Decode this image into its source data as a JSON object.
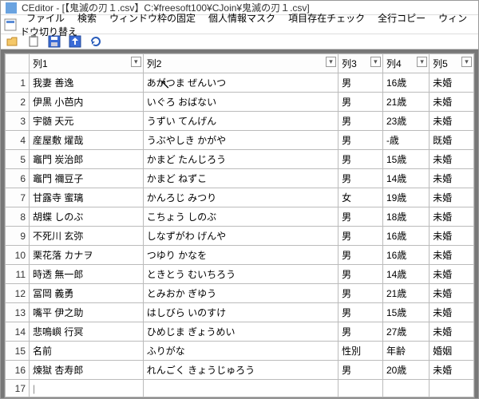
{
  "title": "CEditor - [【鬼滅の刃１.csv】C:¥freesoft100¥CJoin¥鬼滅の刃１.csv]",
  "menus": [
    "ファイル",
    "検索",
    "ウィンドウ枠の固定",
    "個人情報マスク",
    "項目存在チェック",
    "全行コピー",
    "ウィンドウ切り替え"
  ],
  "columns": [
    "",
    "列1",
    "列2",
    "列3",
    "列4",
    "列5"
  ],
  "rows": [
    {
      "n": "1",
      "c": [
        "我妻 善逸",
        "あがつま ぜんいつ",
        "男",
        "16歳",
        "未婚"
      ]
    },
    {
      "n": "2",
      "c": [
        "伊黒 小芭内",
        "いぐろ おばない",
        "男",
        "21歳",
        "未婚"
      ]
    },
    {
      "n": "3",
      "c": [
        "宇髄 天元",
        "うずい てんげん",
        "男",
        "23歳",
        "未婚"
      ]
    },
    {
      "n": "4",
      "c": [
        "産屋敷 燿哉",
        "うぶやしき かがや",
        "男",
        "-歳",
        "既婚"
      ]
    },
    {
      "n": "5",
      "c": [
        "竈門 炭治郎",
        "かまど たんじろう",
        "男",
        "15歳",
        "未婚"
      ]
    },
    {
      "n": "6",
      "c": [
        "竈門 禰豆子",
        "かまど ねずこ",
        "男",
        "14歳",
        "未婚"
      ]
    },
    {
      "n": "7",
      "c": [
        "甘露寺 蜜璃",
        "かんろじ みつり",
        "女",
        "19歳",
        "未婚"
      ]
    },
    {
      "n": "8",
      "c": [
        "胡蝶 しのぶ",
        "こちょう しのぶ",
        "男",
        "18歳",
        "未婚"
      ]
    },
    {
      "n": "9",
      "c": [
        "不死川 玄弥",
        "しなずがわ げんや",
        "男",
        "16歳",
        "未婚"
      ]
    },
    {
      "n": "10",
      "c": [
        "栗花落 カナヲ",
        "つゆり かなを",
        "男",
        "16歳",
        "未婚"
      ]
    },
    {
      "n": "11",
      "c": [
        "時透 無一郎",
        "ときとう むいちろう",
        "男",
        "14歳",
        "未婚"
      ]
    },
    {
      "n": "12",
      "c": [
        "冨岡 義勇",
        "とみおか ぎゆう",
        "男",
        "21歳",
        "未婚"
      ]
    },
    {
      "n": "13",
      "c": [
        "嘴平 伊之助",
        "はしびら いのすけ",
        "男",
        "15歳",
        "未婚"
      ]
    },
    {
      "n": "14",
      "c": [
        "悲鳴嶼 行冥",
        "ひめじま ぎょうめい",
        "男",
        "27歳",
        "未婚"
      ]
    },
    {
      "n": "15",
      "c": [
        "名前",
        "ふりがな",
        "性別",
        "年齢",
        "婚姻"
      ]
    },
    {
      "n": "16",
      "c": [
        "煉獄 杏寿郎",
        "れんごく きょうじゅろう",
        "男",
        "20歳",
        "未婚"
      ]
    },
    {
      "n": "17",
      "c": [
        "",
        "",
        "",
        "",
        ""
      ]
    }
  ],
  "new_row_marker": "▸*"
}
